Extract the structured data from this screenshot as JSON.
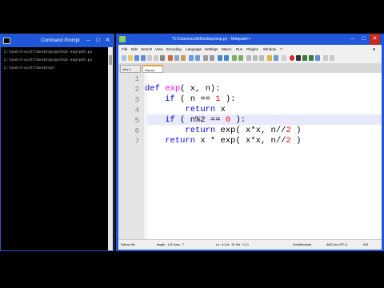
{
  "cmd": {
    "title": "Command Prompt",
    "lines": [
      "C:\\Users\\scott\\Desktop>python exprpoh.py",
      "C:\\Users\\scott\\Desktop>python exprpoh.py",
      "C:\\Users\\scott\\Desktop>"
    ]
  },
  "npp": {
    "title": "*C:\\Users\\scott\\Desktop\\exp.py - Notepad++",
    "menu": [
      "File",
      "Edit",
      "Search",
      "View",
      "Encoding",
      "Language",
      "Settings",
      "Macro",
      "Run",
      "Plugins",
      "Window",
      "?"
    ],
    "tabs": [
      "new 1",
      "exp.py"
    ],
    "code_lines": [
      {
        "n": "1",
        "tokens": []
      },
      {
        "n": "2",
        "tokens": [
          {
            "t": "def ",
            "c": "kw"
          },
          {
            "t": "exp",
            "c": "fn"
          },
          {
            "t": "( x, n):",
            "c": ""
          }
        ]
      },
      {
        "n": "3",
        "tokens": [
          {
            "t": "    ",
            "c": ""
          },
          {
            "t": "if",
            "c": "kw"
          },
          {
            "t": " ( n == ",
            "c": ""
          },
          {
            "t": "1",
            "c": "num"
          },
          {
            "t": " ):",
            "c": ""
          }
        ]
      },
      {
        "n": "4",
        "tokens": [
          {
            "t": "        ",
            "c": ""
          },
          {
            "t": "return",
            "c": "kw"
          },
          {
            "t": " x",
            "c": ""
          }
        ]
      },
      {
        "n": "5",
        "tokens": [
          {
            "t": "    ",
            "c": ""
          },
          {
            "t": "if",
            "c": "kw"
          },
          {
            "t": " ( n%2 == ",
            "c": ""
          },
          {
            "t": "0",
            "c": "num"
          },
          {
            "t": " ):",
            "c": ""
          }
        ]
      },
      {
        "n": "6",
        "tokens": [
          {
            "t": "        ",
            "c": ""
          },
          {
            "t": "return",
            "c": "kw"
          },
          {
            "t": " exp( x*x, n//",
            "c": ""
          },
          {
            "t": "2",
            "c": "num"
          },
          {
            "t": " )",
            "c": ""
          }
        ]
      },
      {
        "n": "7",
        "tokens": [
          {
            "t": "    ",
            "c": ""
          },
          {
            "t": "return",
            "c": "kw"
          },
          {
            "t": " x * exp( x*x, n//",
            "c": ""
          },
          {
            "t": "2",
            "c": "num"
          },
          {
            "t": " )",
            "c": ""
          }
        ]
      }
    ],
    "status": {
      "file_type": "Python file",
      "length": "length : 132    lines : 7",
      "position": "Ln : 6    Col : 32    Sel : 0 | 0",
      "eol": "Dos\\Windows",
      "encoding": "ANSI as UTF-8",
      "mode": "INS"
    }
  },
  "colors": {
    "titlebar": "#1f57d8",
    "keyword": "#0000ff",
    "function": "#ff00ff",
    "number": "#ff0000",
    "current_line": "#e8e8ff"
  }
}
